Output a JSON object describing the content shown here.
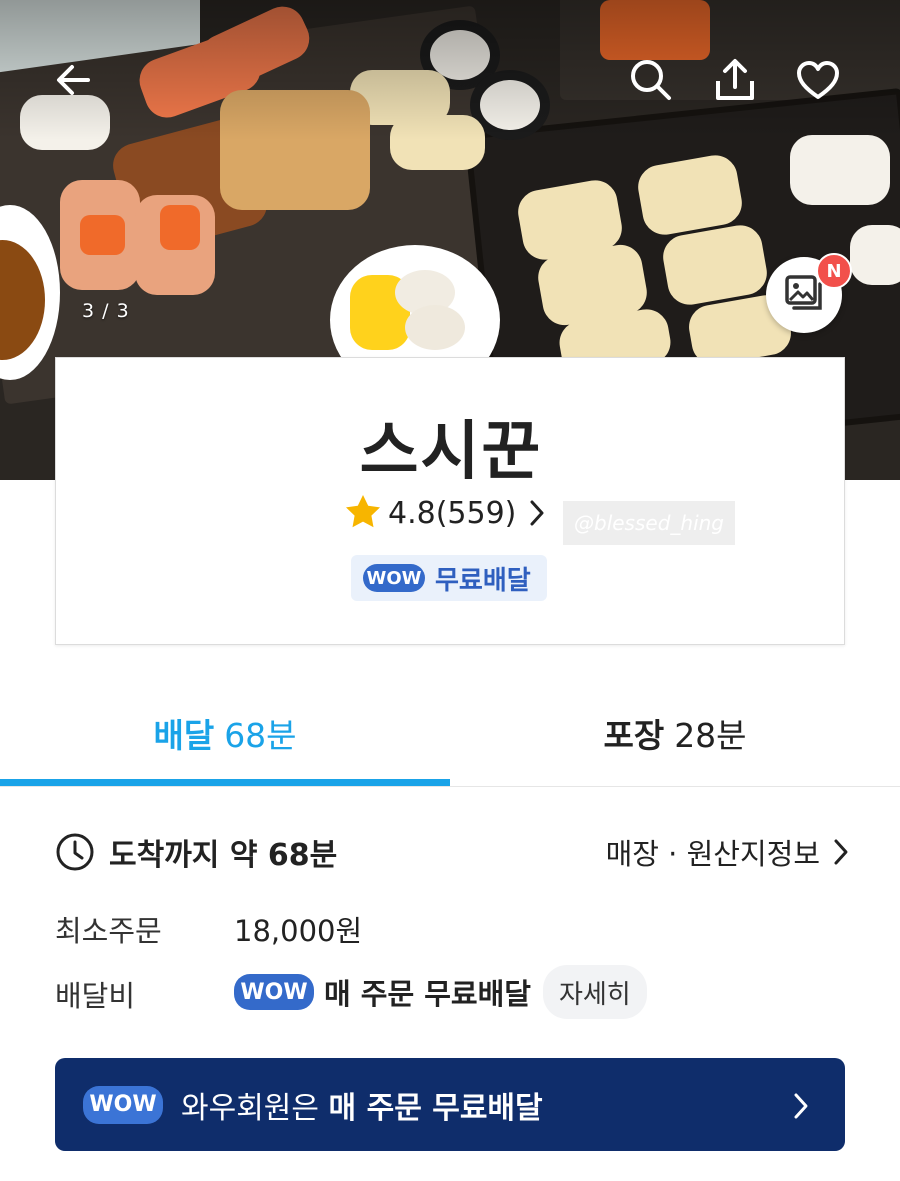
{
  "hero": {
    "page_indicator": "3 / 3",
    "new_badge": "N"
  },
  "icons": {
    "back": "back-arrow-icon",
    "search": "search-icon",
    "share": "share-icon",
    "favorite": "heart-icon",
    "gallery": "photo-gallery-icon",
    "star": "star-icon",
    "rating_chevron": "chevron-right-icon",
    "clock": "clock-icon"
  },
  "store": {
    "name": "스시꾼",
    "rating": "4.8(559)",
    "watermark": "@blessed_hing",
    "wow_label": "WOW",
    "free_delivery_tag": "무료배달"
  },
  "tabs": {
    "delivery_label": "배달",
    "delivery_time": "68분",
    "takeout_label": "포장",
    "takeout_time": "28분"
  },
  "info": {
    "arrival": "도착까지 약 68분",
    "origin_link": "매장 · 원산지정보",
    "min_order_label": "최소주문",
    "min_order_value": "18,000원",
    "delivery_fee_label": "배달비",
    "fee_wow_label": "WOW",
    "fee_text": "매 주문 무료배달",
    "detail_button": "자세히"
  },
  "banner": {
    "wow_label": "WOW",
    "text_prefix": "와우회원은 ",
    "text_bold": "매 주문 무료배달"
  },
  "colors": {
    "accent_blue": "#1aa3e8",
    "wow_blue": "#346aca",
    "banner_navy": "#0f2d6b",
    "star_yellow": "#f7b500",
    "badge_red": "#f2504b"
  }
}
